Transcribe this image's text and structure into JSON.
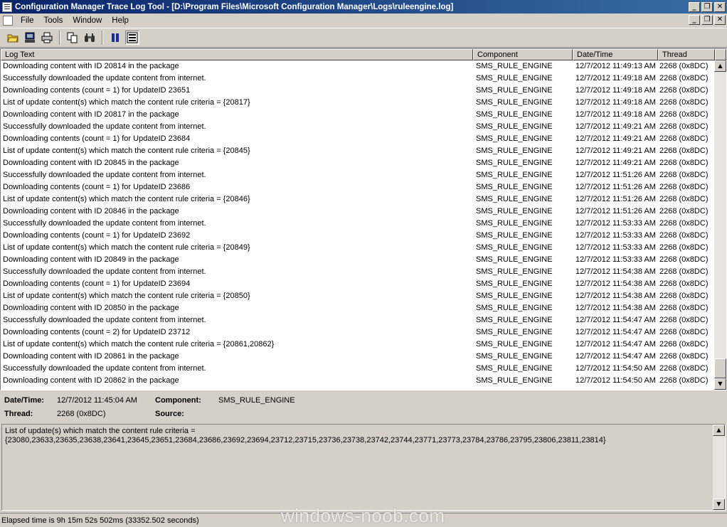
{
  "window": {
    "title": "Configuration Manager Trace Log Tool - [D:\\Program Files\\Microsoft Configuration Manager\\Logs\\ruleengine.log]",
    "min": "0",
    "restore": "1",
    "close": "r"
  },
  "menu": {
    "items": [
      "File",
      "Tools",
      "Window",
      "Help"
    ]
  },
  "toolbar": {
    "icons": [
      "open-folder-icon",
      "save-icon",
      "print-icon",
      "copy-icon",
      "find-icon",
      "pause-icon",
      "highlight-icon"
    ]
  },
  "log": {
    "columns": [
      "Log Text",
      "Component",
      "Date/Time",
      "Thread"
    ],
    "rows": [
      [
        "Downloading content with ID 20814 in the package",
        "SMS_RULE_ENGINE",
        "12/7/2012 11:49:13 AM",
        "2268 (0x8DC)"
      ],
      [
        "Successfully downloaded the update content from internet.",
        "SMS_RULE_ENGINE",
        "12/7/2012 11:49:18 AM",
        "2268 (0x8DC)"
      ],
      [
        "Downloading contents (count = 1) for UpdateID 23651",
        "SMS_RULE_ENGINE",
        "12/7/2012 11:49:18 AM",
        "2268 (0x8DC)"
      ],
      [
        "List of update content(s) which match the content rule criteria = {20817}",
        "SMS_RULE_ENGINE",
        "12/7/2012 11:49:18 AM",
        "2268 (0x8DC)"
      ],
      [
        "Downloading content with ID 20817 in the package",
        "SMS_RULE_ENGINE",
        "12/7/2012 11:49:18 AM",
        "2268 (0x8DC)"
      ],
      [
        "Successfully downloaded the update content from internet.",
        "SMS_RULE_ENGINE",
        "12/7/2012 11:49:21 AM",
        "2268 (0x8DC)"
      ],
      [
        "Downloading contents (count = 1) for UpdateID 23684",
        "SMS_RULE_ENGINE",
        "12/7/2012 11:49:21 AM",
        "2268 (0x8DC)"
      ],
      [
        "List of update content(s) which match the content rule criteria = {20845}",
        "SMS_RULE_ENGINE",
        "12/7/2012 11:49:21 AM",
        "2268 (0x8DC)"
      ],
      [
        "Downloading content with ID 20845 in the package",
        "SMS_RULE_ENGINE",
        "12/7/2012 11:49:21 AM",
        "2268 (0x8DC)"
      ],
      [
        "Successfully downloaded the update content from internet.",
        "SMS_RULE_ENGINE",
        "12/7/2012 11:51:26 AM",
        "2268 (0x8DC)"
      ],
      [
        "Downloading contents (count = 1) for UpdateID 23686",
        "SMS_RULE_ENGINE",
        "12/7/2012 11:51:26 AM",
        "2268 (0x8DC)"
      ],
      [
        "List of update content(s) which match the content rule criteria = {20846}",
        "SMS_RULE_ENGINE",
        "12/7/2012 11:51:26 AM",
        "2268 (0x8DC)"
      ],
      [
        "Downloading content with ID 20846 in the package",
        "SMS_RULE_ENGINE",
        "12/7/2012 11:51:26 AM",
        "2268 (0x8DC)"
      ],
      [
        "Successfully downloaded the update content from internet.",
        "SMS_RULE_ENGINE",
        "12/7/2012 11:53:33 AM",
        "2268 (0x8DC)"
      ],
      [
        "Downloading contents (count = 1) for UpdateID 23692",
        "SMS_RULE_ENGINE",
        "12/7/2012 11:53:33 AM",
        "2268 (0x8DC)"
      ],
      [
        "List of update content(s) which match the content rule criteria = {20849}",
        "SMS_RULE_ENGINE",
        "12/7/2012 11:53:33 AM",
        "2268 (0x8DC)"
      ],
      [
        "Downloading content with ID 20849 in the package",
        "SMS_RULE_ENGINE",
        "12/7/2012 11:53:33 AM",
        "2268 (0x8DC)"
      ],
      [
        "Successfully downloaded the update content from internet.",
        "SMS_RULE_ENGINE",
        "12/7/2012 11:54:38 AM",
        "2268 (0x8DC)"
      ],
      [
        "Downloading contents (count = 1) for UpdateID 23694",
        "SMS_RULE_ENGINE",
        "12/7/2012 11:54:38 AM",
        "2268 (0x8DC)"
      ],
      [
        "List of update content(s) which match the content rule criteria = {20850}",
        "SMS_RULE_ENGINE",
        "12/7/2012 11:54:38 AM",
        "2268 (0x8DC)"
      ],
      [
        "Downloading content with ID 20850 in the package",
        "SMS_RULE_ENGINE",
        "12/7/2012 11:54:38 AM",
        "2268 (0x8DC)"
      ],
      [
        "Successfully downloaded the update content from internet.",
        "SMS_RULE_ENGINE",
        "12/7/2012 11:54:47 AM",
        "2268 (0x8DC)"
      ],
      [
        "Downloading contents (count = 2) for UpdateID 23712",
        "SMS_RULE_ENGINE",
        "12/7/2012 11:54:47 AM",
        "2268 (0x8DC)"
      ],
      [
        "List of update content(s) which match the content rule criteria = {20861,20862}",
        "SMS_RULE_ENGINE",
        "12/7/2012 11:54:47 AM",
        "2268 (0x8DC)"
      ],
      [
        "Downloading content with ID 20861 in the package",
        "SMS_RULE_ENGINE",
        "12/7/2012 11:54:47 AM",
        "2268 (0x8DC)"
      ],
      [
        "Successfully downloaded the update content from internet.",
        "SMS_RULE_ENGINE",
        "12/7/2012 11:54:50 AM",
        "2268 (0x8DC)"
      ],
      [
        "Downloading content with ID 20862 in the package",
        "SMS_RULE_ENGINE",
        "12/7/2012 11:54:50 AM",
        "2268 (0x8DC)"
      ]
    ]
  },
  "details": {
    "datetime_label": "Date/Time:",
    "datetime_value": "12/7/2012 11:45:04 AM",
    "component_label": "Component:",
    "component_value": "SMS_RULE_ENGINE",
    "thread_label": "Thread:",
    "thread_value": "2268 (0x8DC)",
    "source_label": "Source:",
    "source_value": ""
  },
  "message": {
    "text": "List of update(s) which match the content rule criteria =\n{23080,23633,23635,23638,23641,23645,23651,23684,23686,23692,23694,23712,23715,23736,23738,23742,23744,23771,23773,23784,23786,23795,23806,23811,23814}"
  },
  "status": {
    "text": "Elapsed time is 9h 15m 52s 502ms (33352.502 seconds)"
  },
  "watermark": "windows-noob.com"
}
